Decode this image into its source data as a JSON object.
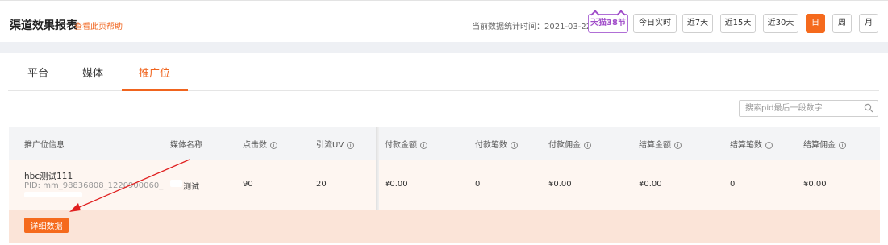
{
  "header": {
    "title": "渠道效果报表",
    "help_link": "查看此页帮助",
    "stat_time_label": "当前数据统计时间：",
    "stat_time_value": "2021-03-22",
    "promo_badge": "天猫38节"
  },
  "time_ranges": [
    {
      "label": "今日实时",
      "active": false
    },
    {
      "label": "近7天",
      "active": false
    },
    {
      "label": "近15天",
      "active": false
    },
    {
      "label": "近30天",
      "active": false
    },
    {
      "label": "日",
      "active": true
    },
    {
      "label": "周",
      "active": false
    },
    {
      "label": "月",
      "active": false
    }
  ],
  "tabs": [
    {
      "label": "平台",
      "active": false
    },
    {
      "label": "媒体",
      "active": false
    },
    {
      "label": "推广位",
      "active": true
    }
  ],
  "search": {
    "placeholder": "搜索pid最后一段数字"
  },
  "table": {
    "columns": [
      "推广位信息",
      "媒体名称",
      "点击数",
      "引流UV",
      "付款金额",
      "付款笔数",
      "付款佣金",
      "结算金额",
      "结算笔数",
      "结算佣金"
    ],
    "row": {
      "name": "hbc测试111",
      "pid": "PID: mm_98836808_1220900060_",
      "media": "测试",
      "clicks": "90",
      "uv": "20",
      "pay_amount": "¥0.00",
      "pay_count": "0",
      "pay_commission": "¥0.00",
      "settle_amount": "¥0.00",
      "settle_count": "0",
      "settle_commission": "¥0.00"
    },
    "detail_button": "详细数据"
  },
  "colors": {
    "accent": "#f56a1d",
    "annotation_arrow": "#e02020"
  }
}
